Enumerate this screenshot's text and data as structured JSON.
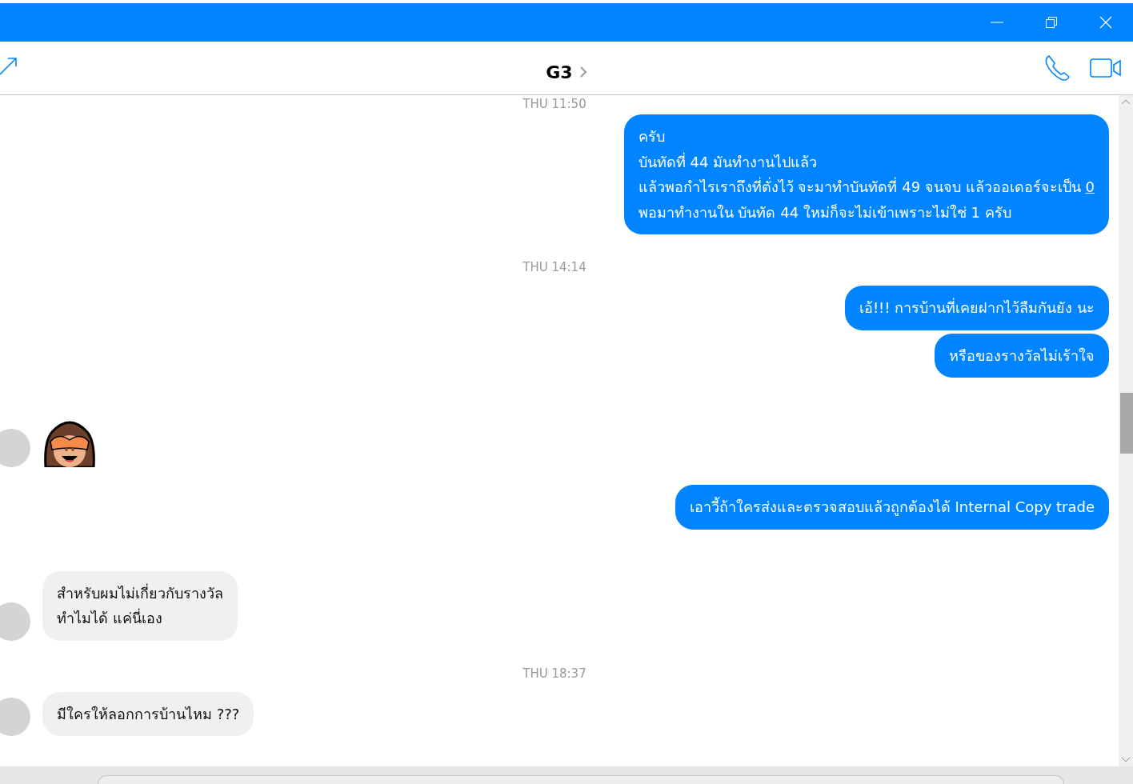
{
  "conversation": {
    "title": "G3"
  },
  "messages": [
    {
      "kind": "time",
      "text": "THU 11:50"
    },
    {
      "kind": "outgoing",
      "lines": [
        {
          "text": "ครับ"
        },
        {
          "text": "บันทัดที่ 44 มันทำงานไปแล้ว"
        },
        {
          "text": "แล้วพอกำไรเราถึงที่ตั่งไว้ จะมาทำบันทัดที่ 49 จนจบ แล้วออเดอร์จะเป็น",
          "link": "0"
        },
        {
          "text": "พอมาทำงานใน บันทัด 44 ใหม่ก็จะไม่เข้าเพราะไม่ใช่ 1 ครับ"
        }
      ]
    },
    {
      "kind": "time",
      "text": "THU 14:14"
    },
    {
      "kind": "outgoing",
      "lines": [
        {
          "text": "เอ้!!! การบ้านที่เคยฝากไว้ลืมกันยัง นะ"
        }
      ]
    },
    {
      "kind": "outgoing",
      "lines": [
        {
          "text": "หรือของรางวัลไม่เร้าใจ"
        }
      ]
    },
    {
      "kind": "sticker"
    },
    {
      "kind": "outgoing",
      "lines": [
        {
          "text": "เอาวี้ถ้าใครส่งและตรวจสอบแล้วถูกต้องได้ Internal Copy trade"
        }
      ]
    },
    {
      "kind": "incoming",
      "lines": [
        {
          "text": "สำหรับผมไม่เกี่ยวกับรางวัล"
        },
        {
          "text": "ทำไมได้ แค่นี่เอง"
        }
      ]
    },
    {
      "kind": "time",
      "text": "THU 18:37"
    },
    {
      "kind": "incoming",
      "lines": [
        {
          "text": "มีใครให้ลอกการบ้านไหม ???"
        }
      ]
    }
  ]
}
